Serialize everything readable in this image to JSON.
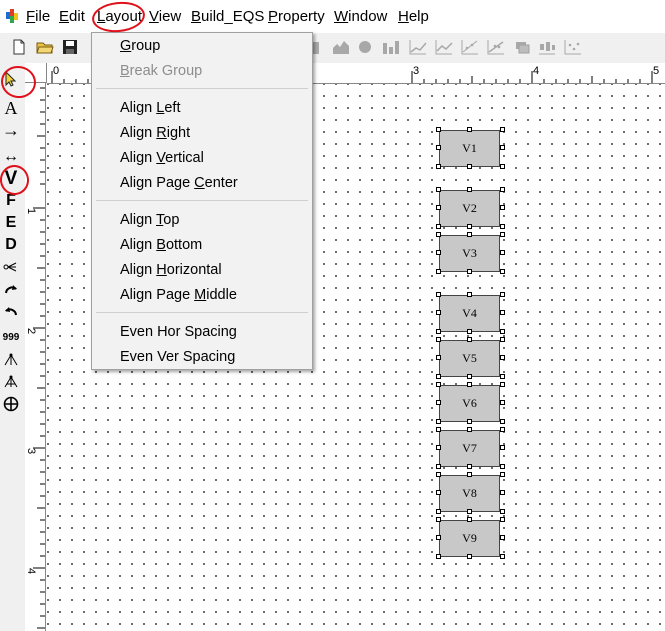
{
  "menubar": {
    "items": [
      {
        "label": "File",
        "ul": "F",
        "rest": "ile"
      },
      {
        "label": "Edit",
        "ul": "E",
        "rest": "dit"
      },
      {
        "label": "Layout",
        "ul": "L",
        "rest": "ayout"
      },
      {
        "label": "View",
        "ul": "V",
        "rest": "iew"
      },
      {
        "label": "Build_EQS",
        "ul": "B",
        "rest": "uild_EQS"
      },
      {
        "label": "Property",
        "ul": "P",
        "rest": "roperty"
      },
      {
        "label": "Window",
        "ul": "W",
        "rest": "indow"
      },
      {
        "label": "Help",
        "ul": "H",
        "rest": "elp"
      }
    ]
  },
  "layout_menu": {
    "group1": [
      {
        "pre": "",
        "ul": "G",
        "post": "roup",
        "disabled": false
      },
      {
        "pre": "",
        "ul": "B",
        "post": "reak Group",
        "disabled": true
      }
    ],
    "group2": [
      {
        "pre": "Align ",
        "ul": "L",
        "post": "eft"
      },
      {
        "pre": "Align ",
        "ul": "R",
        "post": "ight"
      },
      {
        "pre": "Align ",
        "ul": "V",
        "post": "ertical"
      },
      {
        "pre": "Align Page ",
        "ul": "C",
        "post": "enter"
      }
    ],
    "group3": [
      {
        "pre": "Align ",
        "ul": "T",
        "post": "op"
      },
      {
        "pre": "Align ",
        "ul": "B",
        "post": "ottom"
      },
      {
        "pre": "Align ",
        "ul": "H",
        "post": "orizontal"
      },
      {
        "pre": "Align Page ",
        "ul": "M",
        "post": "iddle"
      }
    ],
    "group4": [
      {
        "pre": "Even Hor Spacing",
        "ul": "",
        "post": ""
      },
      {
        "pre": "Even Ver Spacing",
        "ul": "",
        "post": ""
      }
    ]
  },
  "palette": {
    "tools": [
      "pointer-icon",
      "A",
      "→",
      "↔",
      "V",
      "F",
      "E",
      "D",
      "multi-arrow-icon",
      "curve-cw-icon",
      "curve-ccw-icon",
      "999",
      "fan-out-icon",
      "fan-out-2-icon",
      "crosshair-circle-icon"
    ]
  },
  "ruler": {
    "top_labels": [
      "0",
      "3",
      "4",
      "5"
    ],
    "left_labels": [
      "1",
      "2",
      "3",
      "4"
    ]
  },
  "canvas": {
    "nodes": [
      "V1",
      "V2",
      "V3",
      "V4",
      "V5",
      "V6",
      "V7",
      "V8",
      "V9"
    ]
  },
  "colors": {
    "annotation": "#e0101a",
    "node_fill": "#c8c8c8",
    "menu_bg": "#f2f2f2"
  }
}
